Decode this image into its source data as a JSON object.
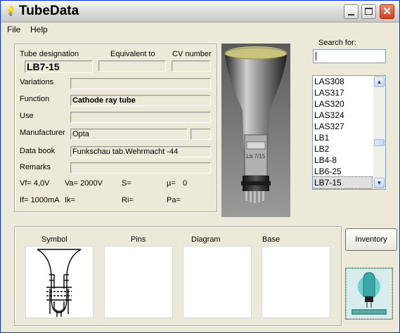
{
  "window": {
    "title": "TubeData"
  },
  "menu": {
    "file": "File",
    "help": "Help"
  },
  "labels": {
    "tube_designation": "Tube designation",
    "equivalent_to": "Equivalent to",
    "cv_number": "CV number",
    "variations": "Variations",
    "function": "Function",
    "use": "Use",
    "manufacturer": "Manufacturer",
    "data_book": "Data book",
    "remarks": "Remarks",
    "search_for": "Search for:",
    "symbol": "Symbol",
    "pins": "Pins",
    "diagram": "Diagram",
    "base": "Base"
  },
  "fields": {
    "tube_designation": "LB7-15",
    "equivalent_to": "",
    "cv_number": "",
    "variations": "",
    "function": "Cathode ray tube",
    "use": "",
    "manufacturer": "Opta",
    "manufacturer_extra": "",
    "data_book": "Funkschau tab.Wehrmacht -44",
    "remarks": ""
  },
  "params": {
    "vf": "Vf= 4,0V",
    "va": "Va= 2000V",
    "s": "S=",
    "mu": "µ=",
    "mu_value": "0",
    "if": "If= 1000mA",
    "ik": "Ik=",
    "ri": "Ri=",
    "pa": "Pa="
  },
  "search": {
    "value": ""
  },
  "tube_list": {
    "items": [
      "LAS308",
      "LAS317",
      "LAS320",
      "LAS324",
      "LAS327",
      "LB1",
      "LB2",
      "LB4-8",
      "LB6-25",
      "LB7-15"
    ],
    "selected": "LB7-15",
    "scroll_position": 0.62
  },
  "buttons": {
    "inventory": "Inventory"
  },
  "photo": {
    "tube_label": "Lb 7/15"
  },
  "colors": {
    "title_bar": "#dcdcdc",
    "close_button": "#d0401a",
    "window_bg": "#ece9d8"
  },
  "icons": {
    "app": "lightbulb-icon",
    "minimize": "minimize-icon",
    "maximize": "maximize-icon",
    "close": "close-icon"
  }
}
